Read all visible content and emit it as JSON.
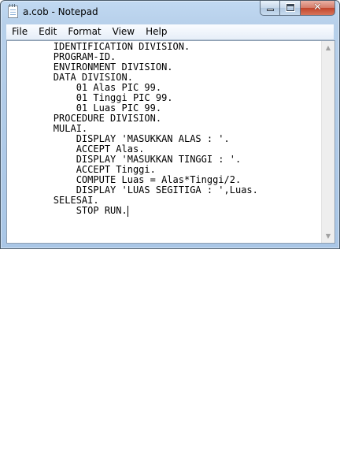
{
  "window": {
    "title": "a.cob - Notepad"
  },
  "caption": {
    "minimize_icon": "minimize-icon",
    "maximize_icon": "maximize-icon",
    "close_glyph": "✕"
  },
  "menu": {
    "items": [
      {
        "label": "File"
      },
      {
        "label": "Edit"
      },
      {
        "label": "Format"
      },
      {
        "label": "View"
      },
      {
        "label": "Help"
      }
    ]
  },
  "editor": {
    "lines": [
      "        IDENTIFICATION DIVISION.",
      "        PROGRAM-ID.",
      "        ENVIRONMENT DIVISION.",
      "        DATA DIVISION.",
      "            01 Alas PIC 99.",
      "            01 Tinggi PIC 99.",
      "            01 Luas PIC 99.",
      "        PROCEDURE DIVISION.",
      "        MULAI.",
      "            DISPLAY 'MASUKKAN ALAS : '.",
      "            ACCEPT Alas.",
      "            DISPLAY 'MASUKKAN TINGGI : '.",
      "            ACCEPT Tinggi.",
      "            COMPUTE Luas = Alas*Tinggi/2.",
      "            DISPLAY 'LUAS SEGITIGA : ',Luas.",
      "        SELESAI.",
      "            STOP RUN."
    ]
  },
  "scrollbar": {
    "up_arrow": "▲",
    "down_arrow": "▼"
  }
}
